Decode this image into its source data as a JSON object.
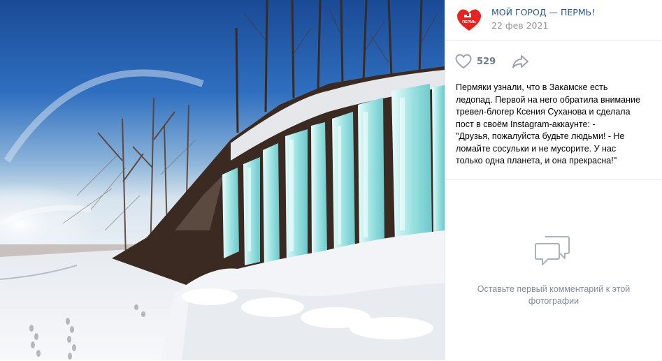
{
  "photo": {
    "alt": "Закамский ледопад",
    "colors": {
      "sky_top": "#1d4f9c",
      "sky_low": "#cfe0ee",
      "ice": "#9fe6e6",
      "snow": "#f2f4f7"
    }
  },
  "post": {
    "group_name": "МОЙ ГОРОД — ПЕРМЬ!",
    "avatar_text": "ПЕРМЬ",
    "date": "22 фев 2021",
    "likes": "529",
    "text_lines": [
      "Пермяки узнали, что в Закамске есть",
      "ледопад. Первой на него обратила внимание",
      "тревел-блогер Ксения Суханова и сделала",
      "пост в своём Instagram-аккаунте: -",
      "\"Друзья, пожалуйста будьте людьми! - Не",
      "ломайте сосульки и не мусорите. У нас",
      "только одна планета, и она прекрасна!\""
    ]
  },
  "comments": {
    "empty_text": "Оставьте первый комментарий к этой фотографии"
  },
  "icons": {
    "avatar": "heart-logo-icon",
    "like": "heart-outline-icon",
    "share": "share-arrow-icon",
    "comments": "comment-bubbles-icon"
  },
  "theme": {
    "link": "#2a5885",
    "muted": "#939393",
    "icon": "#99a2ad",
    "brand_red": "#e52421"
  }
}
